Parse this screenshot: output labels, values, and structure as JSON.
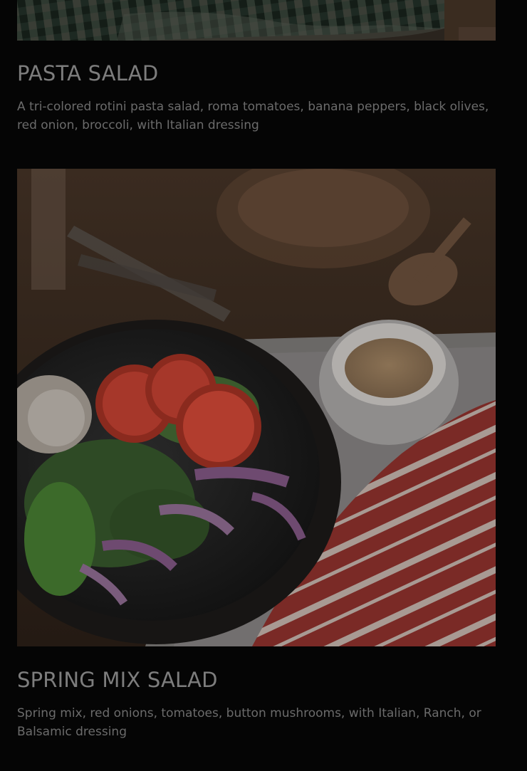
{
  "menu_items": [
    {
      "title": "PASTA SALAD",
      "description": "A tri-colored rotini pasta salad, roma tomatoes, banana peppers, black olives, red onion, broccoli, with Italian dressing",
      "image_subject": "pasta-salad-on-plaid-cloth"
    },
    {
      "title": "SPRING MIX SALAD",
      "description": "Spring mix, red onions, tomatoes, button mushrooms, with Italian, Ranch, or Balsamic dressing",
      "image_subject": "spring-mix-salad-bowl-with-dressing"
    }
  ],
  "colors": {
    "background": "#050505",
    "title": "#7d7d7d",
    "description": "#6b6b6b"
  }
}
